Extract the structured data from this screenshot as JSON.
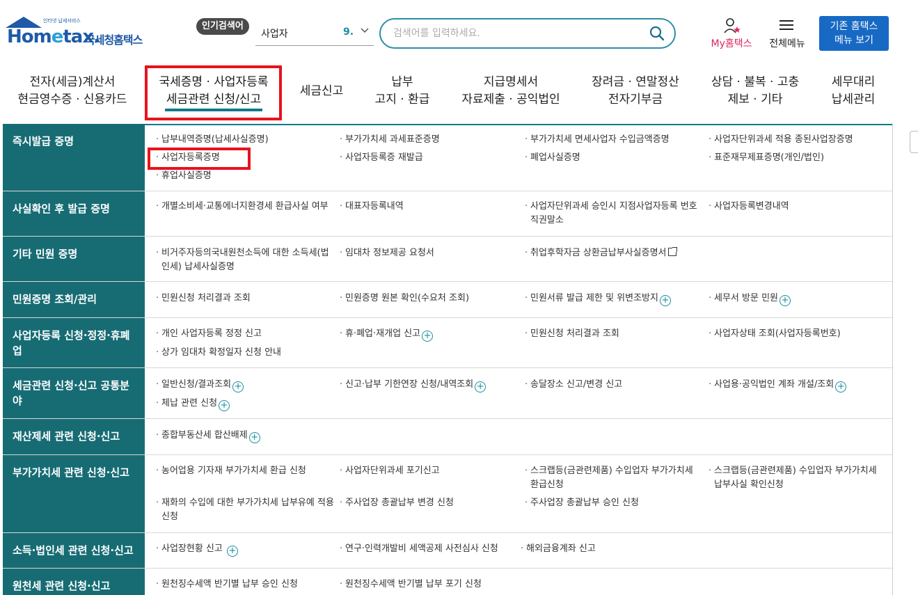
{
  "header": {
    "logo_sub": "인터넷 납세서비스",
    "logo_word_a": "Hom",
    "logo_word_e": "e",
    "logo_word_b": "tax.",
    "logo_kor": "국세청홈택스",
    "popular_badge": "인기검색어",
    "popular_term": "사업자",
    "popular_rank": "9.",
    "search_placeholder": "검색어를 입력하세요.",
    "my_hometax": "My홈택스",
    "all_menu": "전체메뉴",
    "old_menu_line1": "기존 홈택스",
    "old_menu_line2": "메뉴 보기"
  },
  "gnb": [
    {
      "l1": "전자(세금)계산서",
      "l2": "현금영수증 · 신용카드"
    },
    {
      "l1": "국세증명 · 사업자등록",
      "l2": "세금관련 신청/신고"
    },
    {
      "l1": "세금신고",
      "l2": ""
    },
    {
      "l1": "납부",
      "l2": "고지 · 환급"
    },
    {
      "l1": "지급명세서",
      "l2": "자료제출 · 공익법인"
    },
    {
      "l1": "장려금 · 연말정산",
      "l2": "전자기부금"
    },
    {
      "l1": "상담 · 불복 · 고충",
      "l2": "제보 · 기타"
    },
    {
      "l1": "세무대리",
      "l2": "납세관리"
    }
  ],
  "sections": [
    {
      "title": "즉시발급 증명",
      "items": [
        "납부내역증명(납세사실증명)",
        "부가가치세 과세표준증명",
        "부가가치세 면세사업자 수입금액증명",
        "사업자단위과세 적용 종된사업장증명",
        "사업자등록증명",
        "사업자등록증 재발급",
        "폐업사실증명",
        "표준재무제표증명(개인/법인)",
        "휴업사실증명"
      ]
    },
    {
      "title": "사실확인 후 발급 증명",
      "items": [
        "개별소비세·교통에너지환경세 환급사실 여부",
        "대표자등록내역",
        "사업자단위과세 승인시 지점사업자등록 번호 직권말소",
        "사업자등록변경내역"
      ]
    },
    {
      "title": "기타 민원 증명",
      "items": [
        "비거주자등의국내원천소득에 대한 소득세(법인세) 납세사실증명",
        "임대차 정보제공 요청서",
        "취업후학자금 상환금납부사실증명서"
      ]
    },
    {
      "title": "민원증명 조회/관리",
      "items": [
        "민원신청 처리결과 조회",
        "민원증명 원본 확인(수요처 조회)",
        "민원서류 발급 제한 및 위변조방지",
        "세무서 방문 민원"
      ]
    },
    {
      "title": "사업자등록 신청·정정·휴폐업",
      "items": [
        "개인 사업자등록 정정 신고",
        "휴·폐업·재개업 신고",
        "민원신청 처리결과 조회",
        "사업자상태 조회(사업자등록번호)",
        "상가 임대차 확정일자 신청 안내"
      ]
    },
    {
      "title": "세금관련 신청·신고 공통분야",
      "items": [
        "일반신청/결과조회",
        "신고·납부 기한연장 신청/내역조회",
        "송달장소 신고/변경 신고",
        "사업용·공익법인 계좌 개설/조회",
        "체납 관련 신청"
      ]
    },
    {
      "title": "재산제세 관련 신청·신고",
      "items": [
        "종합부동산세 합산배제"
      ]
    },
    {
      "title": "부가가치세 관련 신청·신고",
      "items": [
        "농어업용 기자재 부가가치세 환급 신청",
        "사업자단위과세 포기신고",
        "스크랩등(금관련제품) 수입업자 부가가치세 환급신청",
        "스크랩등(금관련제품) 수입업자 부가가치세 납부사실 확인신청",
        "재화의 수입에 대한 부가가치세 납부유예 적용 신청",
        "주사업장 총괄납부 변경 신청",
        "주사업장 총괄납부 승인 신청"
      ]
    },
    {
      "title": "소득·법인세 관련 신청·신고",
      "items": [
        "사업장현황 신고",
        "연구·인력개발비 세액공제 사전심사 신청",
        "해외금융계좌 신고"
      ]
    },
    {
      "title": "원천세 관련 신청·신고",
      "items": [
        "원천징수세액 반기별 납부 승인 신청",
        "원천징수세액 반기별 납부 포기 신청"
      ]
    }
  ]
}
